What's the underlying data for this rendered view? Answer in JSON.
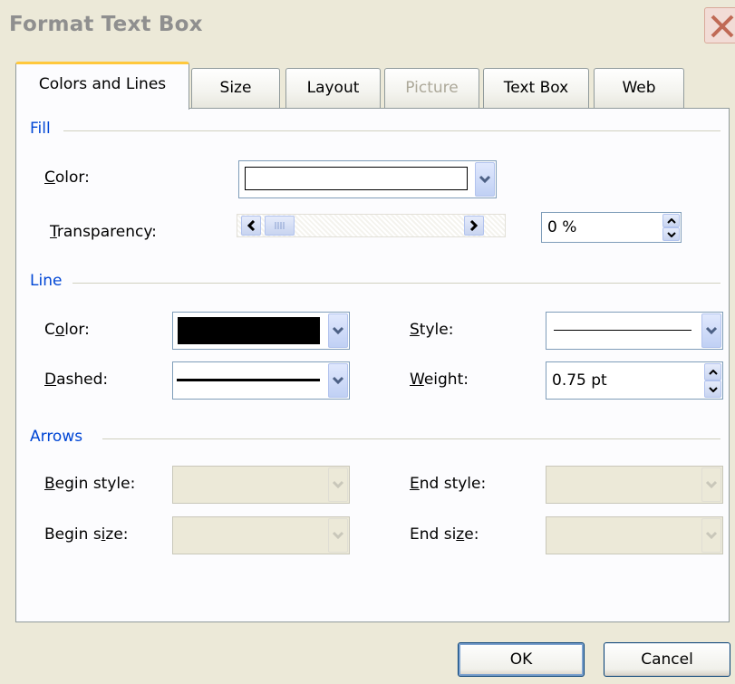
{
  "window": {
    "title": "Format Text Box"
  },
  "tabs": [
    {
      "label": "Colors and Lines",
      "active": true,
      "enabled": true
    },
    {
      "label": "Size",
      "active": false,
      "enabled": true
    },
    {
      "label": "Layout",
      "active": false,
      "enabled": true
    },
    {
      "label": "Picture",
      "active": false,
      "enabled": false
    },
    {
      "label": "Text Box",
      "active": false,
      "enabled": true
    },
    {
      "label": "Web",
      "active": false,
      "enabled": true
    }
  ],
  "fill": {
    "section_title": "Fill",
    "color_label_mnemonic": "C",
    "color_label_rest": "olor:",
    "color_value": "#ffffff",
    "transparency_label_mnemonic": "T",
    "transparency_label_rest": "ransparency:",
    "transparency_value": "0 %",
    "transparency_slider_fraction": 0.0
  },
  "line": {
    "section_title": "Line",
    "color_label_mnemonic": "o",
    "color_label_pre": "C",
    "color_label_post": "lor:",
    "color_value": "#000000",
    "dashed_label_mnemonic": "D",
    "dashed_label_rest": "ashed:",
    "style_label_mnemonic": "S",
    "style_label_rest": "tyle:",
    "weight_label_mnemonic": "W",
    "weight_label_rest": "eight:",
    "weight_value": "0.75 pt"
  },
  "arrows": {
    "section_title": "Arrows",
    "begin_style_label_mnemonic": "B",
    "begin_style_label_rest": "egin style:",
    "begin_size_label_pre": "Begin s",
    "begin_size_label_mnemonic": "i",
    "begin_size_label_post": "ze:",
    "end_style_label_mnemonic": "E",
    "end_style_label_rest": "nd style:",
    "end_size_label_pre": "End si",
    "end_size_label_mnemonic": "z",
    "end_size_label_post": "e:"
  },
  "buttons": {
    "ok": "OK",
    "cancel": "Cancel"
  },
  "colors": {
    "accent": "#0046d5",
    "dialog_bg": "#ece9d8",
    "tab_highlight": "#ffc83c"
  }
}
